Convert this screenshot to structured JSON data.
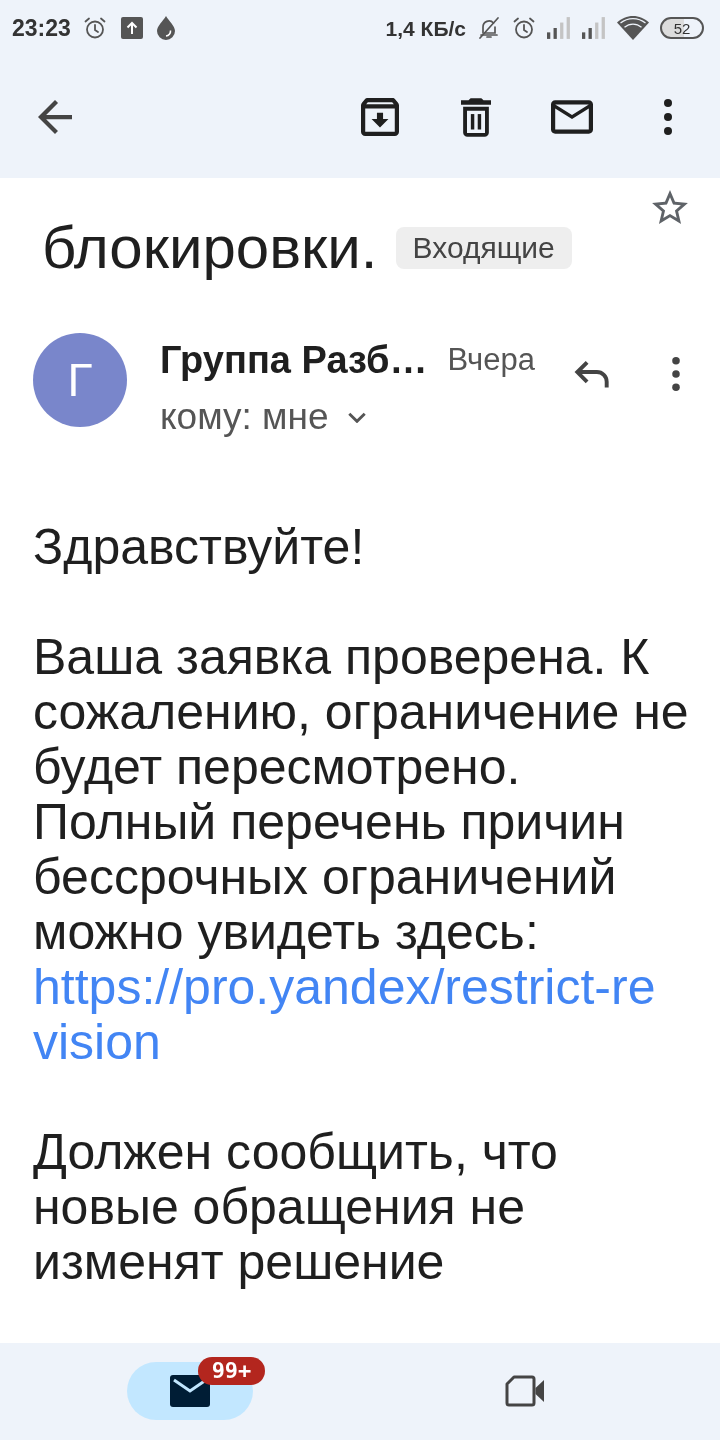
{
  "status_bar": {
    "time": "23:23",
    "speed": "1,4 КБ/с",
    "battery": "52"
  },
  "message": {
    "subject": "блокировки.",
    "label": "Входящие",
    "starred": false,
    "sender": {
      "initial": "Г",
      "name": "Группа Разб…",
      "date": "Вчера",
      "recipient": "кому: мне"
    },
    "body": [
      {
        "text": "Здравствуйте!"
      },
      {
        "text": "Ваша заявка проверена. К\nсожалению, ограничение не\nбудет пересмотрено.\nПолный перечень причин\nбессрочных ограничений\nможно увидеть здесь:",
        "link": "https://pro.yandex/restrict-revision"
      },
      {
        "text": "Должен сообщить, что\nновые обращения не\nизменят решение"
      }
    ]
  },
  "bottom_nav": {
    "items": [
      {
        "kind": "mail",
        "selected": true,
        "badge": "99+"
      },
      {
        "kind": "video",
        "selected": false
      }
    ]
  }
}
